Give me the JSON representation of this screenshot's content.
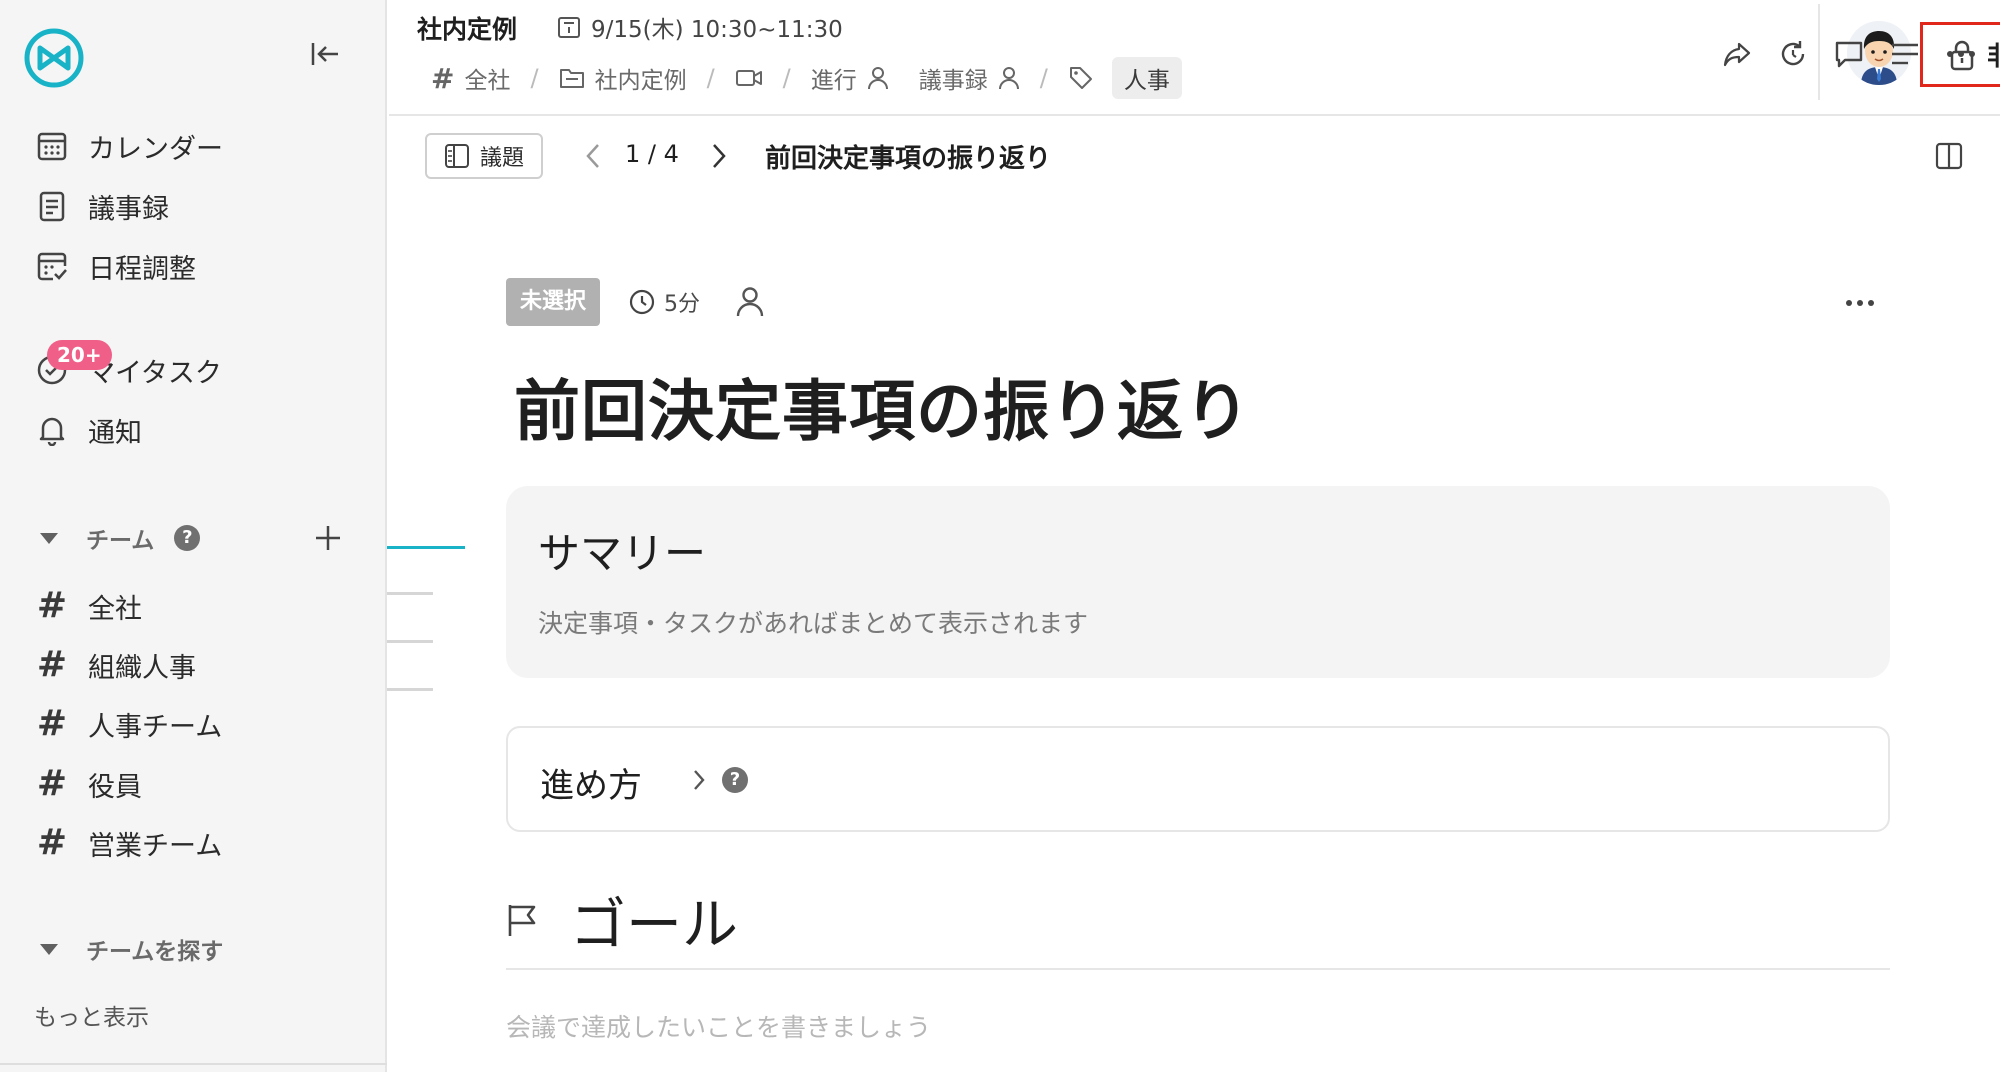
{
  "colors": {
    "brand": "#19b3c7",
    "private_outline": "#e1261c",
    "badge": "#ef5f88",
    "status_chip": "#b1b1b1",
    "sidebar_bg": "#f5f5f5"
  },
  "sidebar": {
    "logo_icon": "brand-logo-icon",
    "collapse_icon": "collapse-sidebar-icon",
    "nav": [
      {
        "label": "カレンダー",
        "icon": "calendar-icon"
      },
      {
        "label": "議事録",
        "icon": "document-icon"
      },
      {
        "label": "日程調整",
        "icon": "schedule-check-icon"
      }
    ],
    "my_tasks": {
      "label": "マイタスク",
      "badge": "20+",
      "icon": "task-circle-icon"
    },
    "notifications": {
      "label": "通知",
      "icon": "bell-icon"
    },
    "teams_section": {
      "label": "チーム",
      "help_icon": "?",
      "add_icon": "plus-icon"
    },
    "teams": [
      {
        "label": "全社"
      },
      {
        "label": "組織人事"
      },
      {
        "label": "人事チーム"
      },
      {
        "label": "役員"
      },
      {
        "label": "営業チーム"
      }
    ],
    "find_teams_section": {
      "label": "チームを探す"
    },
    "more_link": "もっと表示"
  },
  "header": {
    "title": "社内定例",
    "datetime": "9/15(木) 10:30~11:30",
    "breadcrumbs": {
      "channel": "全社",
      "meeting": "社内定例",
      "facilitator": "進行",
      "minutes": "議事録",
      "tag": "人事",
      "separator": "/"
    },
    "privacy_label": "非公開",
    "actions": [
      "share-icon",
      "refresh-icon",
      "comment-icon",
      "outline-list-icon",
      "more-icon"
    ]
  },
  "agenda_bar": {
    "button_label": "議題",
    "position": "1 / 4",
    "current": "前回決定事項の振り返り"
  },
  "agenda_item": {
    "status": "未選択",
    "duration": "5分",
    "title": "前回決定事項の振り返り",
    "summary": {
      "heading": "サマリー",
      "placeholder": "決定事項・タスクがあればまとめて表示されます"
    },
    "howto": {
      "label": "進め方",
      "help": "?"
    },
    "goal": {
      "heading": "ゴール",
      "placeholder": "会議で達成したいことを書きましょう"
    }
  }
}
